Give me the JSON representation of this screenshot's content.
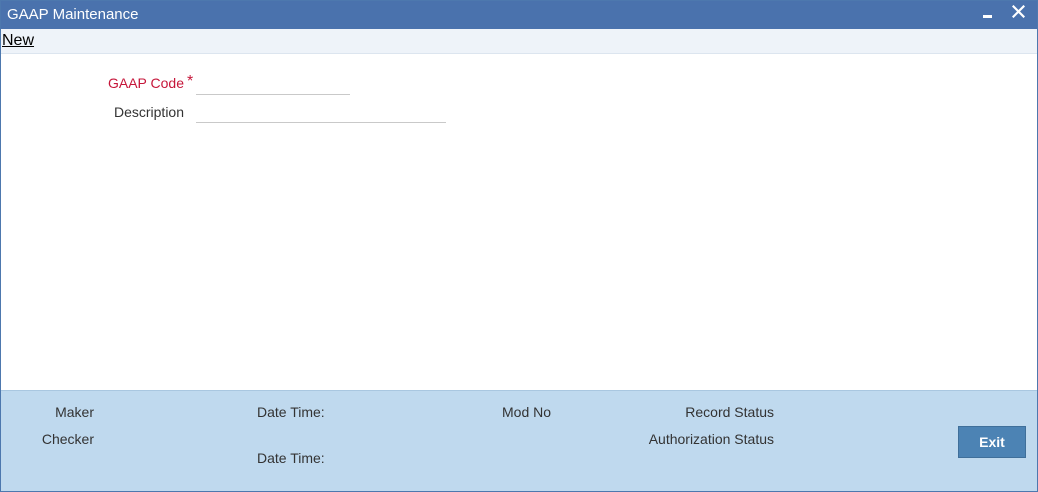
{
  "window": {
    "title": "GAAP Maintenance",
    "minimize_icon": "minimize-icon",
    "close_icon": "close-icon"
  },
  "toolbar": {
    "new_label": "New"
  },
  "form": {
    "gaap_code_label": "GAAP Code",
    "required_marker": "*",
    "gaap_code_value": "",
    "description_label": "Description",
    "description_value": ""
  },
  "footer": {
    "maker_label": "Maker",
    "checker_label": "Checker",
    "date_time_label_1": "Date Time:",
    "date_time_label_2": "Date Time:",
    "mod_no_label": "Mod No",
    "record_status_label": "Record Status",
    "authorization_status_label": "Authorization Status",
    "exit_label": "Exit"
  },
  "colors": {
    "title_bar": "#4a72ad",
    "required_label": "#c6163a",
    "footer_background": "#bfd9ee",
    "exit_button": "#4c83b4"
  }
}
